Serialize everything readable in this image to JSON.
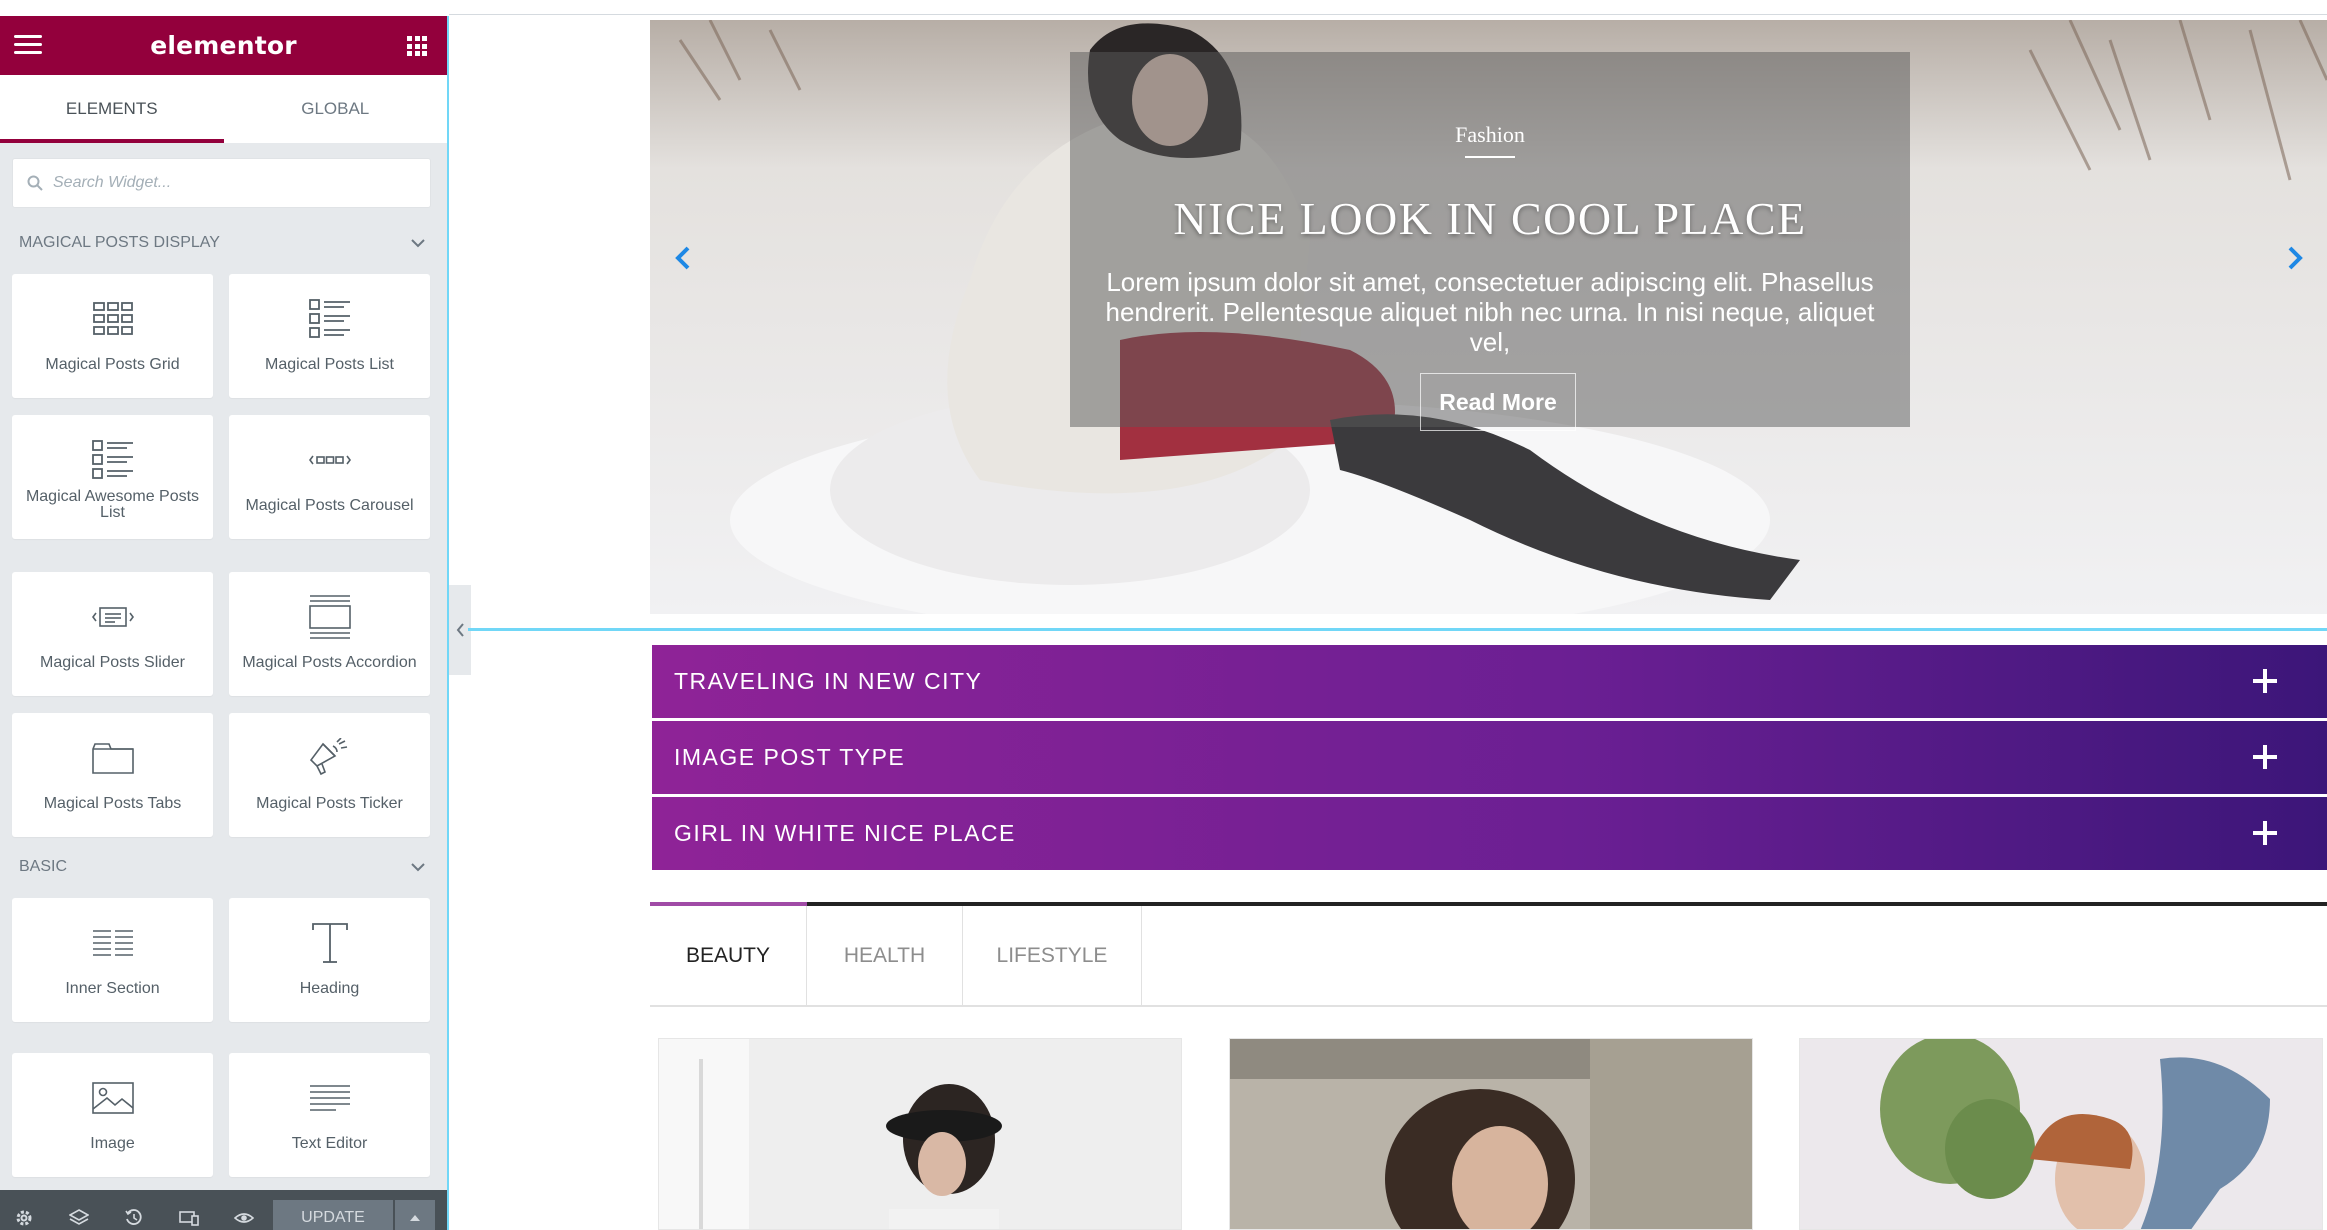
{
  "colors": {
    "brand": "#93003c",
    "panel_bg": "#e6e9ec",
    "accent_line": "#71d7f7",
    "accordion_start": "#8f2397",
    "accordion_end": "#3c1679",
    "active_tab_bar": "#a04ba6"
  },
  "panel": {
    "logo": "elementor",
    "menu_icon": "hamburger-icon",
    "apps_icon": "grid-icon",
    "tabs": [
      {
        "label": "ELEMENTS",
        "active": true
      },
      {
        "label": "GLOBAL",
        "active": false
      }
    ],
    "search": {
      "placeholder": "Search Widget...",
      "value": ""
    },
    "categories": [
      {
        "title": "MAGICAL POSTS DISPLAY",
        "widgets": [
          {
            "label": "Magical Posts Grid",
            "icon": "posts-grid-icon"
          },
          {
            "label": "Magical Posts List",
            "icon": "posts-list-icon"
          },
          {
            "label": "Magical Awesome Posts List",
            "icon": "awesome-list-icon"
          },
          {
            "label": "Magical Posts Carousel",
            "icon": "carousel-icon"
          },
          {
            "label": "Magical Posts Slider",
            "icon": "slider-icon"
          },
          {
            "label": "Magical Posts Accordion",
            "icon": "accordion-icon"
          },
          {
            "label": "Magical Posts Tabs",
            "icon": "tabs-icon"
          },
          {
            "label": "Magical Posts Ticker",
            "icon": "megaphone-icon"
          }
        ]
      },
      {
        "title": "BASIC",
        "widgets": [
          {
            "label": "Inner Section",
            "icon": "inner-section-icon"
          },
          {
            "label": "Heading",
            "icon": "heading-icon"
          },
          {
            "label": "Image",
            "icon": "image-icon"
          },
          {
            "label": "Text Editor",
            "icon": "text-editor-icon"
          }
        ]
      }
    ],
    "footer": {
      "icons": [
        "settings-icon",
        "layers-icon",
        "history-icon",
        "responsive-icon",
        "preview-eye-icon"
      ],
      "update_label": "UPDATE"
    }
  },
  "slider": {
    "category": "Fashion",
    "title": "NICE LOOK IN COOL PLACE",
    "excerpt": "Lorem ipsum dolor sit amet, consectetuer adipiscing elit. Phasellus hendrerit. Pellentesque aliquet nibh nec urna. In nisi neque, aliquet vel,",
    "button": "Read More"
  },
  "accordion": [
    {
      "title": "TRAVELING IN NEW CITY"
    },
    {
      "title": "IMAGE POST TYPE"
    },
    {
      "title": "GIRL IN WHITE NICE PLACE"
    }
  ],
  "post_tabs": [
    {
      "label": "BEAUTY",
      "active": true
    },
    {
      "label": "HEALTH",
      "active": false
    },
    {
      "label": "LIFESTYLE",
      "active": false
    }
  ]
}
